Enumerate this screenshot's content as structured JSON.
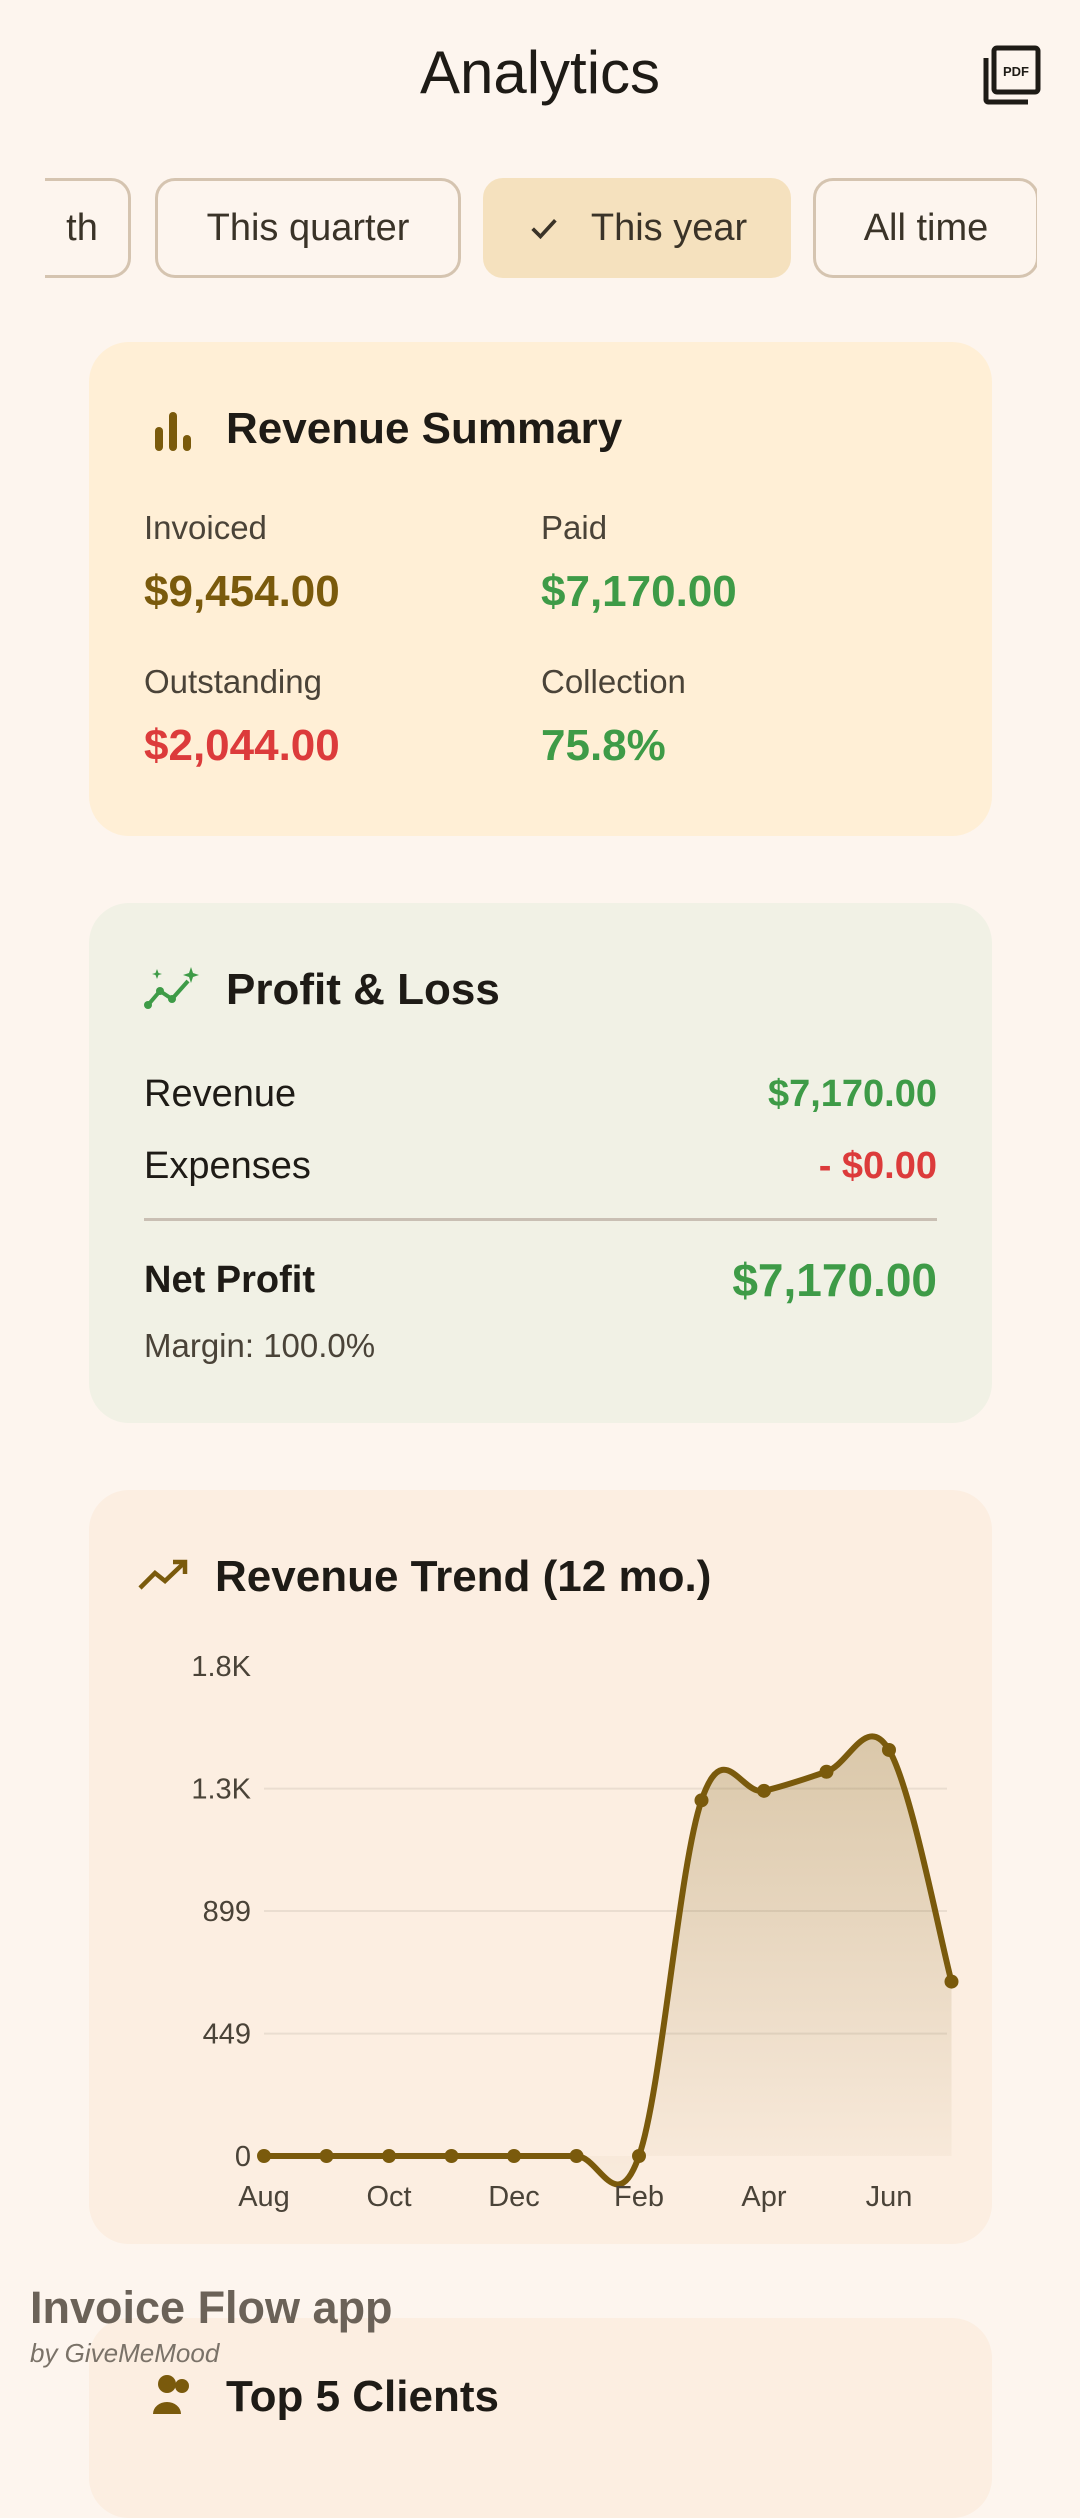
{
  "header": {
    "title": "Analytics",
    "pdf_icon": "pdf-export-icon"
  },
  "filters": {
    "chips": [
      {
        "label": "This month",
        "visible_label": "th",
        "selected": false
      },
      {
        "label": "This quarter",
        "selected": false
      },
      {
        "label": "This year",
        "selected": true
      },
      {
        "label": "All time",
        "selected": false
      }
    ]
  },
  "revenue_summary": {
    "title": "Revenue Summary",
    "icon": "bar-chart-icon",
    "invoiced": {
      "label": "Invoiced",
      "value": "$9,454.00"
    },
    "paid": {
      "label": "Paid",
      "value": "$7,170.00"
    },
    "outstanding": {
      "label": "Outstanding",
      "value": "$2,044.00"
    },
    "collection": {
      "label": "Collection",
      "value": "75.8%"
    }
  },
  "profit_loss": {
    "title": "Profit & Loss",
    "icon": "trending-sparkle-icon",
    "revenue": {
      "label": "Revenue",
      "value": "$7,170.00"
    },
    "expenses": {
      "label": "Expenses",
      "value": "- $0.00"
    },
    "net_profit": {
      "label": "Net Profit",
      "value": "$7,170.00"
    },
    "margin": "Margin: 100.0%"
  },
  "revenue_trend": {
    "title": "Revenue Trend (12 mo.)",
    "icon": "trending-up-icon"
  },
  "chart_data": {
    "type": "line",
    "title": "Revenue Trend (12 mo.)",
    "x": [
      "Aug",
      "Sep",
      "Oct",
      "Nov",
      "Dec",
      "Jan",
      "Feb",
      "Mar",
      "Apr",
      "May",
      "Jun",
      "Jul"
    ],
    "x_tick_labels": [
      "Aug",
      "Oct",
      "Dec",
      "Feb",
      "Apr",
      "Jun"
    ],
    "values": [
      0,
      0,
      0,
      0,
      0,
      0,
      0,
      1305,
      1340,
      1410,
      1490,
      640
    ],
    "y_ticks": [
      "0",
      "449",
      "899",
      "1.3K",
      "1.8K"
    ],
    "y_tick_values": [
      0,
      449,
      899,
      1348,
      1798
    ],
    "ylim": [
      0,
      1798
    ],
    "grid": true,
    "line_color": "#7A5A0C"
  },
  "top_clients": {
    "title": "Top 5 Clients",
    "icon": "people-icon"
  },
  "branding": {
    "main": "Invoice Flow app",
    "sub": "by GiveMeMood"
  }
}
